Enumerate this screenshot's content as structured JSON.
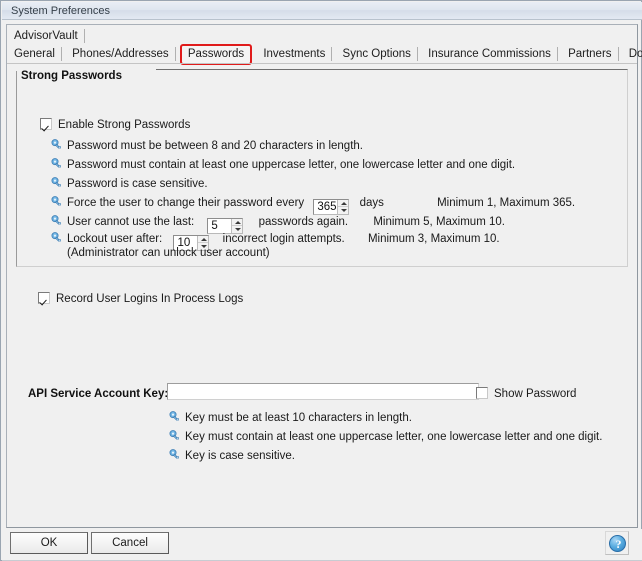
{
  "window": {
    "title": "System Preferences"
  },
  "tabs_row1": [
    {
      "label": "AdvisorVault",
      "selected": true
    }
  ],
  "tabs_row2": [
    {
      "label": "General",
      "selected": false,
      "highlighted": false
    },
    {
      "label": "Phones/Addresses",
      "selected": false,
      "highlighted": false
    },
    {
      "label": "Passwords",
      "selected": true,
      "highlighted": true
    },
    {
      "label": "Investments",
      "selected": false,
      "highlighted": false
    },
    {
      "label": "Sync Options",
      "selected": false,
      "highlighted": false
    },
    {
      "label": "Insurance Commissions",
      "selected": false,
      "highlighted": false
    },
    {
      "label": "Partners",
      "selected": false,
      "highlighted": false
    },
    {
      "label": "Docupace",
      "selected": false,
      "highlighted": false
    }
  ],
  "strong_passwords": {
    "group_title": "Strong Passwords",
    "enable_checkbox": {
      "label": "Enable Strong Passwords",
      "checked": true
    },
    "rules": [
      {
        "text": "Password must be between 8 and 20 characters in length."
      },
      {
        "text": "Password must contain at least one uppercase letter, one lowercase letter and one digit."
      },
      {
        "text": "Password is case sensitive."
      }
    ],
    "force_change": {
      "prefix": "Force the user to change their password every",
      "value": "365",
      "suffix": "days",
      "range_note": "Minimum 1, Maximum 365."
    },
    "last_passwords": {
      "prefix": "User cannot use the last:",
      "value": "5",
      "suffix": "passwords again.",
      "range_note": "Minimum 5, Maximum 10."
    },
    "lockout": {
      "prefix": "Lockout user after:",
      "value": "10",
      "suffix": "incorrect login attempts.",
      "range_note": "Minimum 3, Maximum 10."
    },
    "admin_note": "(Administrator can unlock user account)"
  },
  "record_logins": {
    "label": "Record User Logins In Process Logs",
    "checked": true
  },
  "api_section": {
    "label": "API Service Account Key:",
    "value": "",
    "placeholder": "",
    "show_password": {
      "label": "Show Password",
      "checked": false
    },
    "rules": [
      {
        "text": "Key must be at least 10 characters in length."
      },
      {
        "text": "Key must contain at least one uppercase letter, one lowercase letter and one digit."
      },
      {
        "text": "Key is case sensitive."
      }
    ]
  },
  "buttons": {
    "ok": "OK",
    "cancel": "Cancel",
    "help_icon": "question-mark-icon",
    "help_glyph": "?"
  },
  "colors": {
    "highlight_red": "#e01b1b",
    "window_bg": "#f0f0f0",
    "titlebar_blue": "#dfe6ef",
    "key_icon_blue": "#5a9fd4"
  }
}
